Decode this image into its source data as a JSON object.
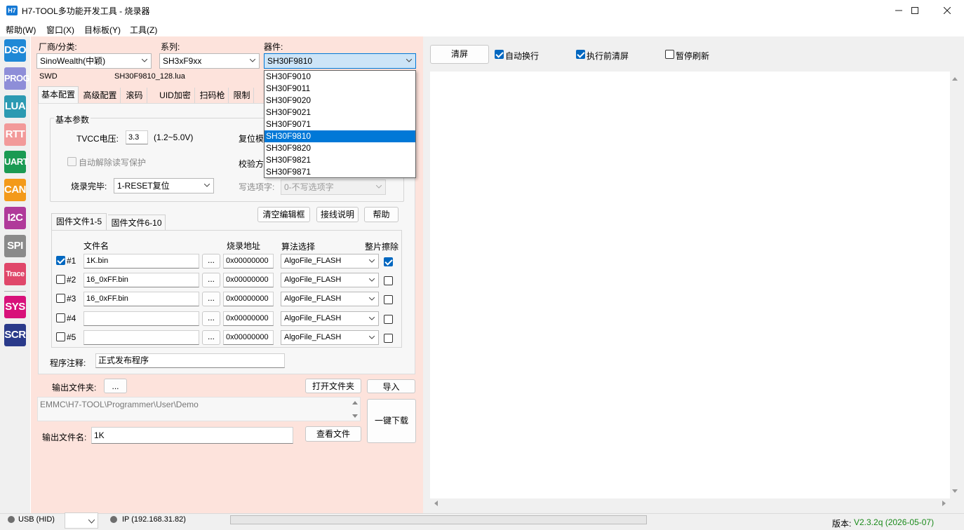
{
  "window": {
    "icon_text": "H7",
    "title": "H7-TOOL多功能开发工具 - 烧录器"
  },
  "menu": [
    "帮助(W)",
    "窗口(X)",
    "目标板(Y)",
    "工具(Z)"
  ],
  "toolbar": [
    {
      "label": "DSO",
      "color": "#1e88d6"
    },
    {
      "label": "PROG",
      "color": "#8e8ed8"
    },
    {
      "label": "LUA",
      "color": "#2c9ab2"
    },
    {
      "label": "RTT",
      "color": "#f29a9a"
    },
    {
      "label": "UART",
      "color": "#1a9a52"
    },
    {
      "label": "CAN",
      "color": "#f39a1a"
    },
    {
      "label": "I2C",
      "color": "#b03a9a"
    },
    {
      "label": "SPI",
      "color": "#8a8a8a"
    },
    {
      "label": "Trace",
      "color": "#e0476a"
    },
    {
      "label": "SYS",
      "color": "#d8117a"
    },
    {
      "label": "SCR",
      "color": "#2a3a8a"
    }
  ],
  "selectors": {
    "vendor_label": "厂商/分类:",
    "vendor_value": "SinoWealth(中颖)",
    "series_label": "系列:",
    "series_value": "SH3xF9xx",
    "device_label": "器件:",
    "device_value": "SH30F9810",
    "interface": "SWD",
    "lua_file": "SH30F9810_128.lua"
  },
  "device_list": {
    "items": [
      "SH30F9010",
      "SH30F9011",
      "SH30F9020",
      "SH30F9021",
      "SH30F9071",
      "SH30F9810",
      "SH30F9820",
      "SH30F9821",
      "SH30F9871"
    ],
    "selected_index": 5
  },
  "tabs": [
    "基本配置",
    "高级配置",
    "滚码",
    "UID加密",
    "扫码枪",
    "限制"
  ],
  "basic": {
    "group_title": "基本参数",
    "tvcc_label": "TVCC电压:",
    "tvcc_value": "3.3",
    "tvcc_range": "(1.2~5.0V)",
    "reset_mode_label": "复位模",
    "auto_unprotect_label": "自动解除读写保护",
    "verify_label": "校验方",
    "after_burn_label": "烧录完毕:",
    "after_burn_value": "1-RESET复位",
    "option_label": "写选项字:",
    "option_value": "0-不写选项字"
  },
  "actions": {
    "clear_edit": "清空编辑框",
    "wiring": "接线说明",
    "help": "帮助"
  },
  "file_tabs": [
    "固件文件1-5",
    "固件文件6-10"
  ],
  "file_table": {
    "headers": {
      "name": "文件名",
      "address": "烧录地址",
      "algo": "算法选择",
      "erase": "整片擦除"
    },
    "browse_label": "...",
    "rows": [
      {
        "id": "#1",
        "enabled": true,
        "file": "1K.bin",
        "address": "0x00000000",
        "algo": "AlgoFile_FLASH",
        "erase": true
      },
      {
        "id": "#2",
        "enabled": false,
        "file": "16_0xFF.bin",
        "address": "0x00000000",
        "algo": "AlgoFile_FLASH",
        "erase": false
      },
      {
        "id": "#3",
        "enabled": false,
        "file": "16_0xFF.bin",
        "address": "0x00000000",
        "algo": "AlgoFile_FLASH",
        "erase": false
      },
      {
        "id": "#4",
        "enabled": false,
        "file": "",
        "address": "0x00000000",
        "algo": "AlgoFile_FLASH",
        "erase": false
      },
      {
        "id": "#5",
        "enabled": false,
        "file": "",
        "address": "0x00000000",
        "algo": "AlgoFile_FLASH",
        "erase": false
      }
    ]
  },
  "comment": {
    "label": "程序注释:",
    "value": "正式发布程序"
  },
  "output": {
    "folder_label": "输出文件夹:",
    "browse_label": "...",
    "open_folder": "打开文件夹",
    "import": "导入",
    "path": "EMMC\\H7-TOOL\\Programmer\\User\\Demo",
    "filename_label": "输出文件名:",
    "filename_value": "1K",
    "view_file": "查看文件",
    "one_click": "一键下载"
  },
  "log_toolbar": {
    "clear": "清屏",
    "auto_wrap": {
      "label": "自动换行",
      "checked": true
    },
    "clear_before_run": {
      "label": "执行前清屏",
      "checked": true
    },
    "pause_refresh": {
      "label": "暂停刷新",
      "checked": false
    }
  },
  "status": {
    "usb": "USB (HID)",
    "ip": "IP (192.168.31.82)",
    "version_label": "版本:",
    "version_value": "V2.3.2q (2026-05-07)",
    "version_color": "#1a8a1a"
  }
}
